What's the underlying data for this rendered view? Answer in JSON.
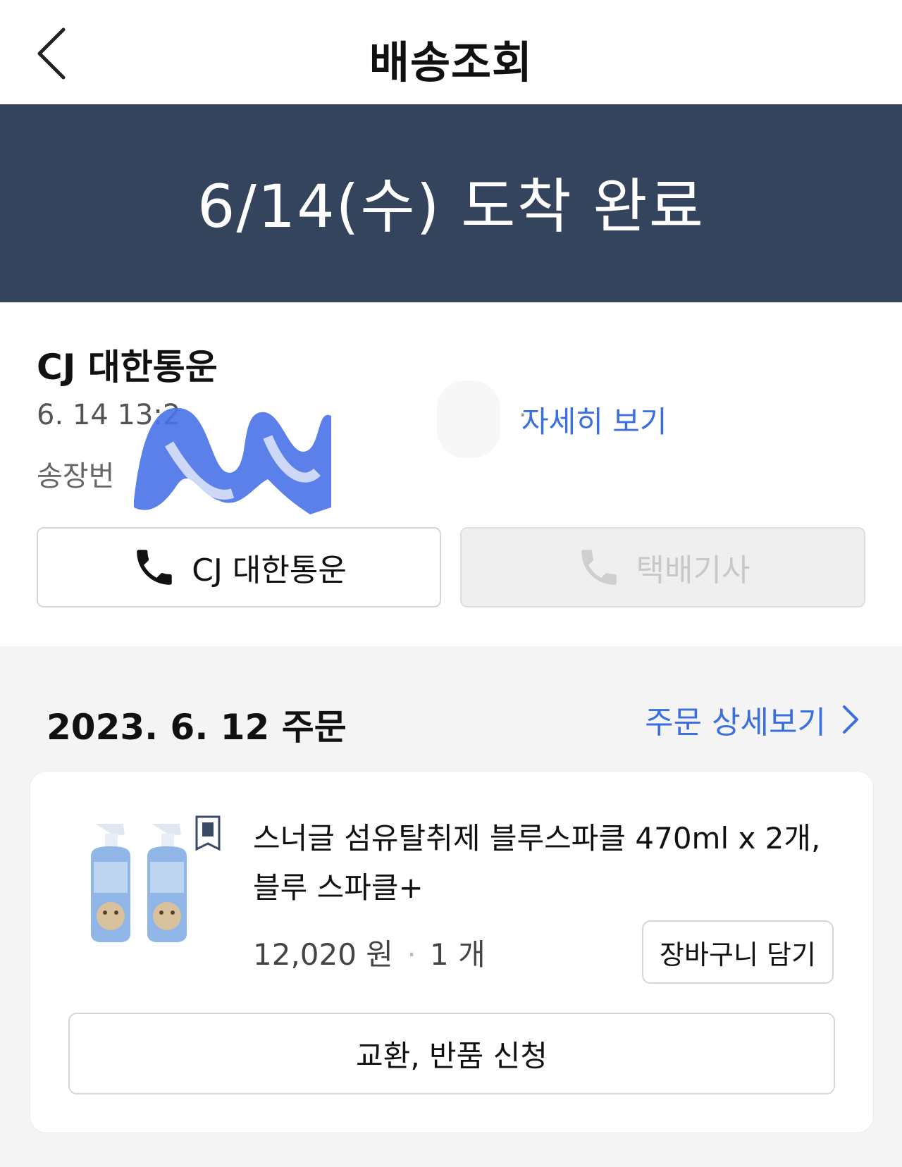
{
  "header": {
    "title": "배송조회",
    "back_icon": "chevron-left-icon"
  },
  "banner": {
    "status_text": "6/14(수) 도착 완료"
  },
  "carrier": {
    "name": "CJ 대한통운",
    "status_time": "6. 14 13:2",
    "detail_link": "자세히 보기",
    "invoice_label": "송장번",
    "buttons": {
      "carrier_call": "CJ 대한통운",
      "driver_call": "택배기사"
    }
  },
  "order": {
    "date_label": "2023. 6. 12 주문",
    "detail_link": "주문 상세보기",
    "item": {
      "name": "스너글 섬유탈취제 블루스파클 470ml x 2개, 블루 스파클+",
      "price": "12,020 원",
      "quantity": "1 개",
      "cart_button": "장바구니 담기"
    },
    "return_button": "교환, 반품 신청"
  },
  "colors": {
    "banner_bg": "#34445d",
    "link_blue": "#3b6fe0"
  }
}
